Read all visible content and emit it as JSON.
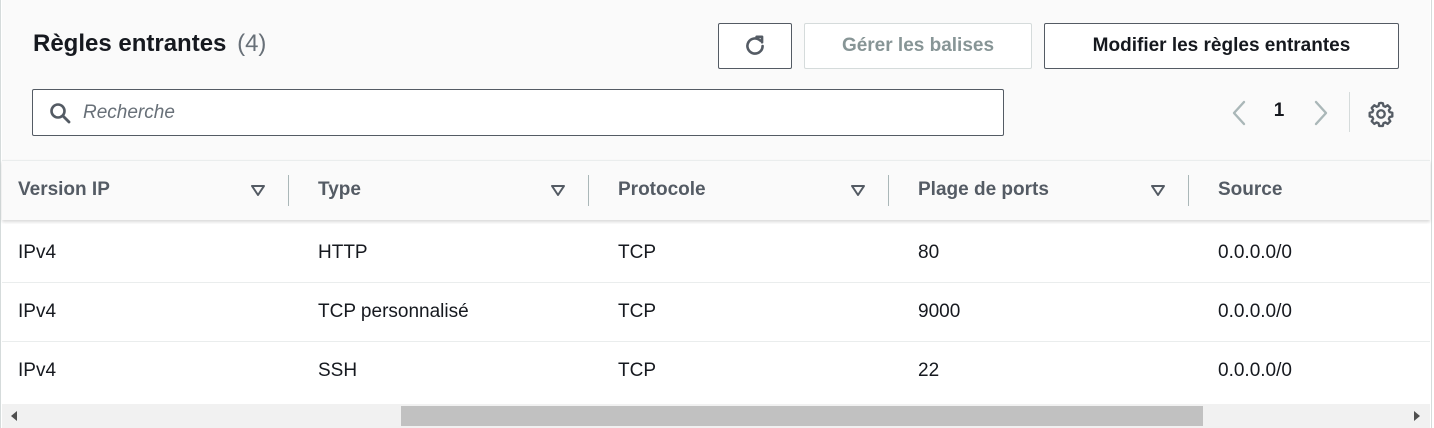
{
  "header": {
    "title": "Règles entrantes",
    "count": "(4)"
  },
  "toolbar": {
    "refresh_icon": "refresh-icon",
    "manage_tags_label": "Gérer les balises",
    "edit_rules_label": "Modifier les règles entrantes"
  },
  "search": {
    "placeholder": "Recherche",
    "value": "",
    "icon": "search-icon"
  },
  "pagination": {
    "current_page": "1",
    "prev_icon": "chevron-left-icon",
    "next_icon": "chevron-right-icon",
    "settings_icon": "gear-icon"
  },
  "table": {
    "columns": [
      "Version IP",
      "Type",
      "Protocole",
      "Plage de ports",
      "Source"
    ],
    "rows": [
      [
        "IPv4",
        "HTTP",
        "TCP",
        "80",
        "0.0.0.0/0"
      ],
      [
        "IPv4",
        "TCP personnalisé",
        "TCP",
        "9000",
        "0.0.0.0/0"
      ],
      [
        "IPv4",
        "SSH",
        "TCP",
        "22",
        "0.0.0.0/0"
      ]
    ]
  },
  "scrollbar": {
    "orientation": "horizontal"
  },
  "colors": {
    "border": "#545b64",
    "text": "#16191f",
    "muted": "#687078",
    "disabled": "#879596",
    "header_bg": "#fafafa"
  }
}
